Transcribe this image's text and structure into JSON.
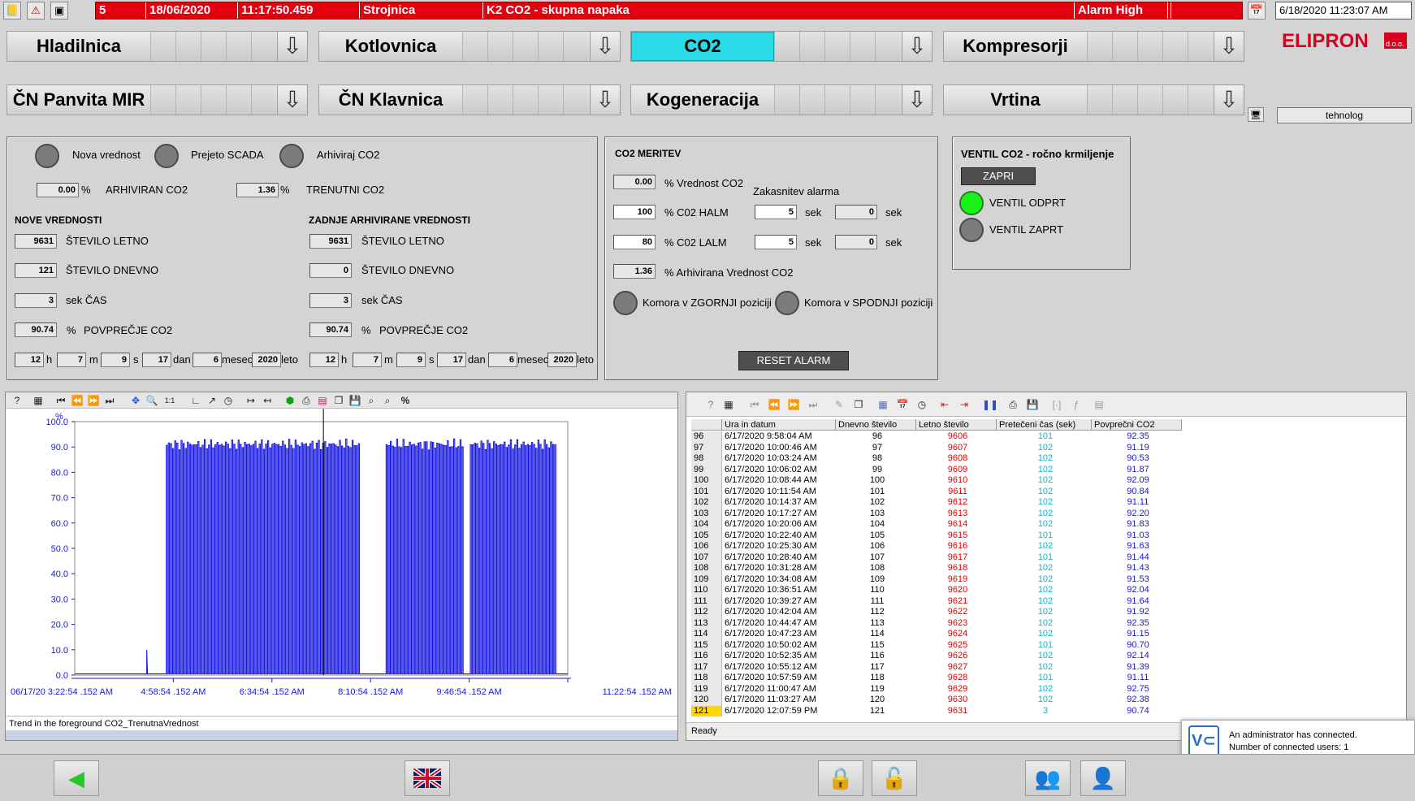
{
  "topbar": {
    "alarm": {
      "number": "5",
      "date": "18/06/2020",
      "time": "11:17:50.459",
      "area": "Strojnica",
      "message": "K2 CO2 - skupna napaka",
      "priority": "Alarm High"
    },
    "clock": "6/18/2020 11:23:07 AM",
    "icons": [
      "notebook-icon",
      "warning-icon",
      "window-icon",
      "calendar-icon"
    ]
  },
  "nav": {
    "row1": [
      {
        "label": "Hladilnica"
      },
      {
        "label": "Kotlovnica"
      },
      {
        "label": "CO2"
      },
      {
        "label": "Kompresorji"
      }
    ],
    "row2": [
      {
        "label": "ČN Panvita MIR"
      },
      {
        "label": "ČN Klavnica"
      },
      {
        "label": "Kogeneracija"
      },
      {
        "label": "Vrtina"
      }
    ],
    "active": "CO2",
    "logo": "ELIPRON",
    "logo_suffix": "d.o.o.",
    "user": "tehnolog"
  },
  "arch": {
    "led_nova": "Nova vrednost",
    "led_prejeto": "Prejeto SCADA",
    "led_arhiviraj": "Arhiviraj CO2",
    "arhiviran_val": "0.00",
    "arhiviran_unit": "%",
    "arhiviran_lbl": "ARHIVIRAN CO2",
    "trenutni_val": "1.36",
    "trenutni_unit": "%",
    "trenutni_lbl": "TRENUTNI CO2",
    "nove_title": "NOVE VREDNOSTI",
    "zadnje_title": "ZADNJE ARHIVIRANE VREDNOSTI",
    "nove": {
      "letno": "9631",
      "letno_lbl": "ŠTEVILO LETNO",
      "dnevno": "121",
      "dnevno_lbl": "ŠTEVILO DNEVNO",
      "cas": "3",
      "cas_lbl": "sek ČAS",
      "povp": "90.74",
      "povp_unit": "%",
      "povp_lbl": "POVPREČJE CO2",
      "h": "12",
      "m": "7",
      "s": "9",
      "dan": "17",
      "mesec": "6",
      "leto": "2020"
    },
    "zadnje": {
      "letno": "9631",
      "letno_lbl": "ŠTEVILO LETNO",
      "dnevno": "0",
      "dnevno_lbl": "ŠTEVILO DNEVNO",
      "cas": "3",
      "cas_lbl": "sek ČAS",
      "povp": "90.74",
      "povp_unit": "%",
      "povp_lbl": "POVPREČJE CO2",
      "h": "12",
      "m": "7",
      "s": "9",
      "dan": "17",
      "mesec": "6",
      "leto": "2020"
    },
    "u_h": "h",
    "u_m": "m",
    "u_s": "s",
    "u_dan": "dan",
    "u_mesec": "mesec",
    "u_leto": "leto"
  },
  "meritev": {
    "title": "CO2 MERITEV",
    "vrednost": "0.00",
    "vrednost_lbl": "% Vrednost CO2",
    "zakasnitev": "Zakasnitev alarma",
    "halm": "100",
    "halm_lbl": "% C02 HALM",
    "halm_delay": "5",
    "halm_cnt": "0",
    "lalm": "80",
    "lalm_lbl": "% C02 LALM",
    "lalm_delay": "5",
    "lalm_cnt": "0",
    "sek": "sek",
    "arhivirana": "1.36",
    "arhivirana_lbl": "% Arhivirana Vrednost CO2",
    "zgornji": "Komora v ZGORNJI poziciji",
    "spodnji": "Komora v SPODNJI poziciji",
    "reset": "RESET ALARM"
  },
  "ventil": {
    "title": "VENTIL CO2  - ročno krmiljenje",
    "zapri": "ZAPRI",
    "odprt": "VENTIL ODPRT",
    "zaprt": "VENTIL ZAPRT"
  },
  "chart_data": {
    "type": "line",
    "ylabel": "%",
    "ylim": [
      0,
      100
    ],
    "yticks": [
      "100.0",
      "90.0",
      "80.0",
      "70.0",
      "60.0",
      "50.0",
      "40.0",
      "30.0",
      "20.0",
      "10.0",
      "0.0"
    ],
    "xticks": [
      "06/17/20  3:22:54 .152 AM",
      "4:58:54 .152 AM",
      "6:34:54 .152 AM",
      "8:10:54 .152 AM",
      "9:46:54 .152 AM",
      "11:22:54 .152 AM"
    ],
    "series": [
      {
        "color": "#1010e0",
        "pulse_level": 91,
        "baseline": 0.5,
        "bursts": [
          {
            "from": "4:52 AM",
            "to": "8:00 AM"
          },
          {
            "from": "8:26 AM",
            "to": "9:41 AM"
          },
          {
            "from": "9:48 AM",
            "to": "11:12 AM"
          }
        ],
        "spike": {
          "at": "4:33 AM",
          "value": 10
        }
      }
    ],
    "cursor_at": "7:25 AM",
    "grid": false,
    "status": "Trend in the foreground CO2_TrenutnaVrednost"
  },
  "table": {
    "columns": [
      "Ura in datum",
      "Dnevno število",
      "Letno število",
      "Pretečeni čas (sek)",
      "Povprečni CO2"
    ],
    "rows": [
      [
        "96",
        "6/17/2020 9:58:04 AM",
        "96",
        "9606",
        "101",
        "92.35"
      ],
      [
        "97",
        "6/17/2020 10:00:46 AM",
        "97",
        "9607",
        "102",
        "91.19"
      ],
      [
        "98",
        "6/17/2020 10:03:24 AM",
        "98",
        "9608",
        "102",
        "90.53"
      ],
      [
        "99",
        "6/17/2020 10:06:02 AM",
        "99",
        "9609",
        "102",
        "91.87"
      ],
      [
        "100",
        "6/17/2020 10:08:44 AM",
        "100",
        "9610",
        "102",
        "92.09"
      ],
      [
        "101",
        "6/17/2020 10:11:54 AM",
        "101",
        "9611",
        "102",
        "90.84"
      ],
      [
        "102",
        "6/17/2020 10:14:37 AM",
        "102",
        "9612",
        "102",
        "91.11"
      ],
      [
        "103",
        "6/17/2020 10:17:27 AM",
        "103",
        "9613",
        "102",
        "92.20"
      ],
      [
        "104",
        "6/17/2020 10:20:06 AM",
        "104",
        "9614",
        "102",
        "91.83"
      ],
      [
        "105",
        "6/17/2020 10:22:40 AM",
        "105",
        "9615",
        "101",
        "91.03"
      ],
      [
        "106",
        "6/17/2020 10:25:30 AM",
        "106",
        "9616",
        "102",
        "91.63"
      ],
      [
        "107",
        "6/17/2020 10:28:40 AM",
        "107",
        "9617",
        "101",
        "91.44"
      ],
      [
        "108",
        "6/17/2020 10:31:28 AM",
        "108",
        "9618",
        "102",
        "91.43"
      ],
      [
        "109",
        "6/17/2020 10:34:08 AM",
        "109",
        "9619",
        "102",
        "91.53"
      ],
      [
        "110",
        "6/17/2020 10:36:51 AM",
        "110",
        "9620",
        "102",
        "92.04"
      ],
      [
        "111",
        "6/17/2020 10:39:27 AM",
        "111",
        "9621",
        "102",
        "91.64"
      ],
      [
        "112",
        "6/17/2020 10:42:04 AM",
        "112",
        "9622",
        "102",
        "91.92"
      ],
      [
        "113",
        "6/17/2020 10:44:47 AM",
        "113",
        "9623",
        "102",
        "92.35"
      ],
      [
        "114",
        "6/17/2020 10:47:23 AM",
        "114",
        "9624",
        "102",
        "91.15"
      ],
      [
        "115",
        "6/17/2020 10:50:02 AM",
        "115",
        "9625",
        "101",
        "90.70"
      ],
      [
        "116",
        "6/17/2020 10:52:35 AM",
        "116",
        "9626",
        "102",
        "92.14"
      ],
      [
        "117",
        "6/17/2020 10:55:12 AM",
        "117",
        "9627",
        "102",
        "91.39"
      ],
      [
        "118",
        "6/17/2020 10:57:59 AM",
        "118",
        "9628",
        "101",
        "91.11"
      ],
      [
        "119",
        "6/17/2020 11:00:47 AM",
        "119",
        "9629",
        "102",
        "92.75"
      ],
      [
        "120",
        "6/17/2020 11:03:27 AM",
        "120",
        "9630",
        "102",
        "92.38"
      ],
      [
        "121",
        "6/17/2020 12:07:59 PM",
        "121",
        "9631",
        "3",
        "90.74"
      ]
    ],
    "status": "Ready"
  },
  "toast": {
    "line1": "An administrator has connected.",
    "line2": "Number of connected users: 1"
  },
  "bottom": {
    "icons": [
      "back-arrow-icon",
      "language-flag-icon",
      "lock-icon",
      "unlock-icon",
      "users-icon",
      "user-icon",
      "power-icon",
      "sound-icon",
      "acknowledge-icon"
    ]
  }
}
